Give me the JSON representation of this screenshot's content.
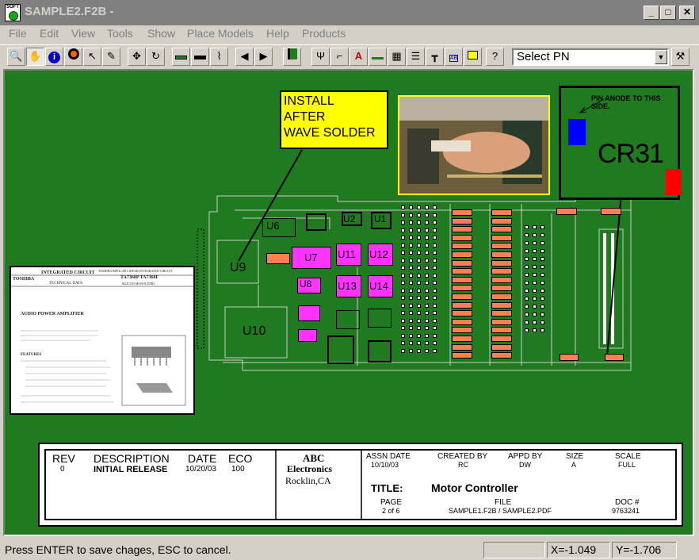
{
  "window": {
    "title": "SAMPLE2.F2B -",
    "app_icon_text": "SOFT"
  },
  "menu": {
    "items": [
      "File",
      "Edit",
      "View",
      "Tools",
      "Show",
      "Place Models",
      "Help",
      "Products"
    ]
  },
  "toolbar": {
    "select_pn": "Select PN"
  },
  "board": {
    "install_note": [
      "INSTALL",
      "AFTER",
      "WAVE SOLDER"
    ],
    "cr31_note": "PIN  ANODE TO THIS SIDE.",
    "cr31_label": "CR31",
    "labels": {
      "u9": "U9",
      "u10": "U10",
      "u6": "U6",
      "u8": "U8",
      "u7": "U7",
      "u11": "U11",
      "u12": "U12",
      "u13": "U13",
      "u14": "U14",
      "u2": "U2",
      "u1": "U1"
    },
    "datasheet": {
      "brand": "TOSHIBA",
      "heading": "INTEGRATED   CIRCUIT",
      "subheading": "TECHNICAL  DATA",
      "part": "TA7368P  TA7368F",
      "desc": "TOSHIBA BIPOLAR LINEAR INTEGRATED CIRCUIT",
      "type": "SILICON MONOLITHIC",
      "section": "AUDIO POWER AMPLIFIER",
      "features": "FEATURES"
    }
  },
  "title_block": {
    "rev_header": "REV",
    "desc_header": "DESCRIPTION",
    "date_header": "DATE",
    "eco_header": "ECO",
    "rev": "0",
    "desc": "INITIAL RELEASE",
    "date": "10/20/03",
    "eco": "100",
    "company": [
      "ABC",
      "Electronics",
      "Rocklin,CA"
    ],
    "assn_date_label": "ASSN DATE",
    "assn_date": "10/10/03",
    "created_by_label": "CREATED BY",
    "created_by": "RC",
    "appd_by_label": "APPD BY",
    "appd_by": "DW",
    "size_label": "SIZE",
    "size": "A",
    "scale_label": "SCALE",
    "scale": "FULL",
    "title_label": "TITLE:",
    "title": "Motor Controller",
    "page_label": "PAGE",
    "page": "2 of 6",
    "file_label": "FILE",
    "file": "SAMPLE1.F2B / SAMPLE2.PDF",
    "doc_label": "DOC #",
    "doc": "9763241"
  },
  "status": {
    "message": "Press ENTER to save chages, ESC to cancel.",
    "x": "X=-1.049",
    "y": "Y=-1.706"
  },
  "colors": {
    "board": "#1f7a20",
    "note": "#ffff00",
    "chip_highlight": "#ff33ff",
    "resistor": "#ff7f50"
  }
}
